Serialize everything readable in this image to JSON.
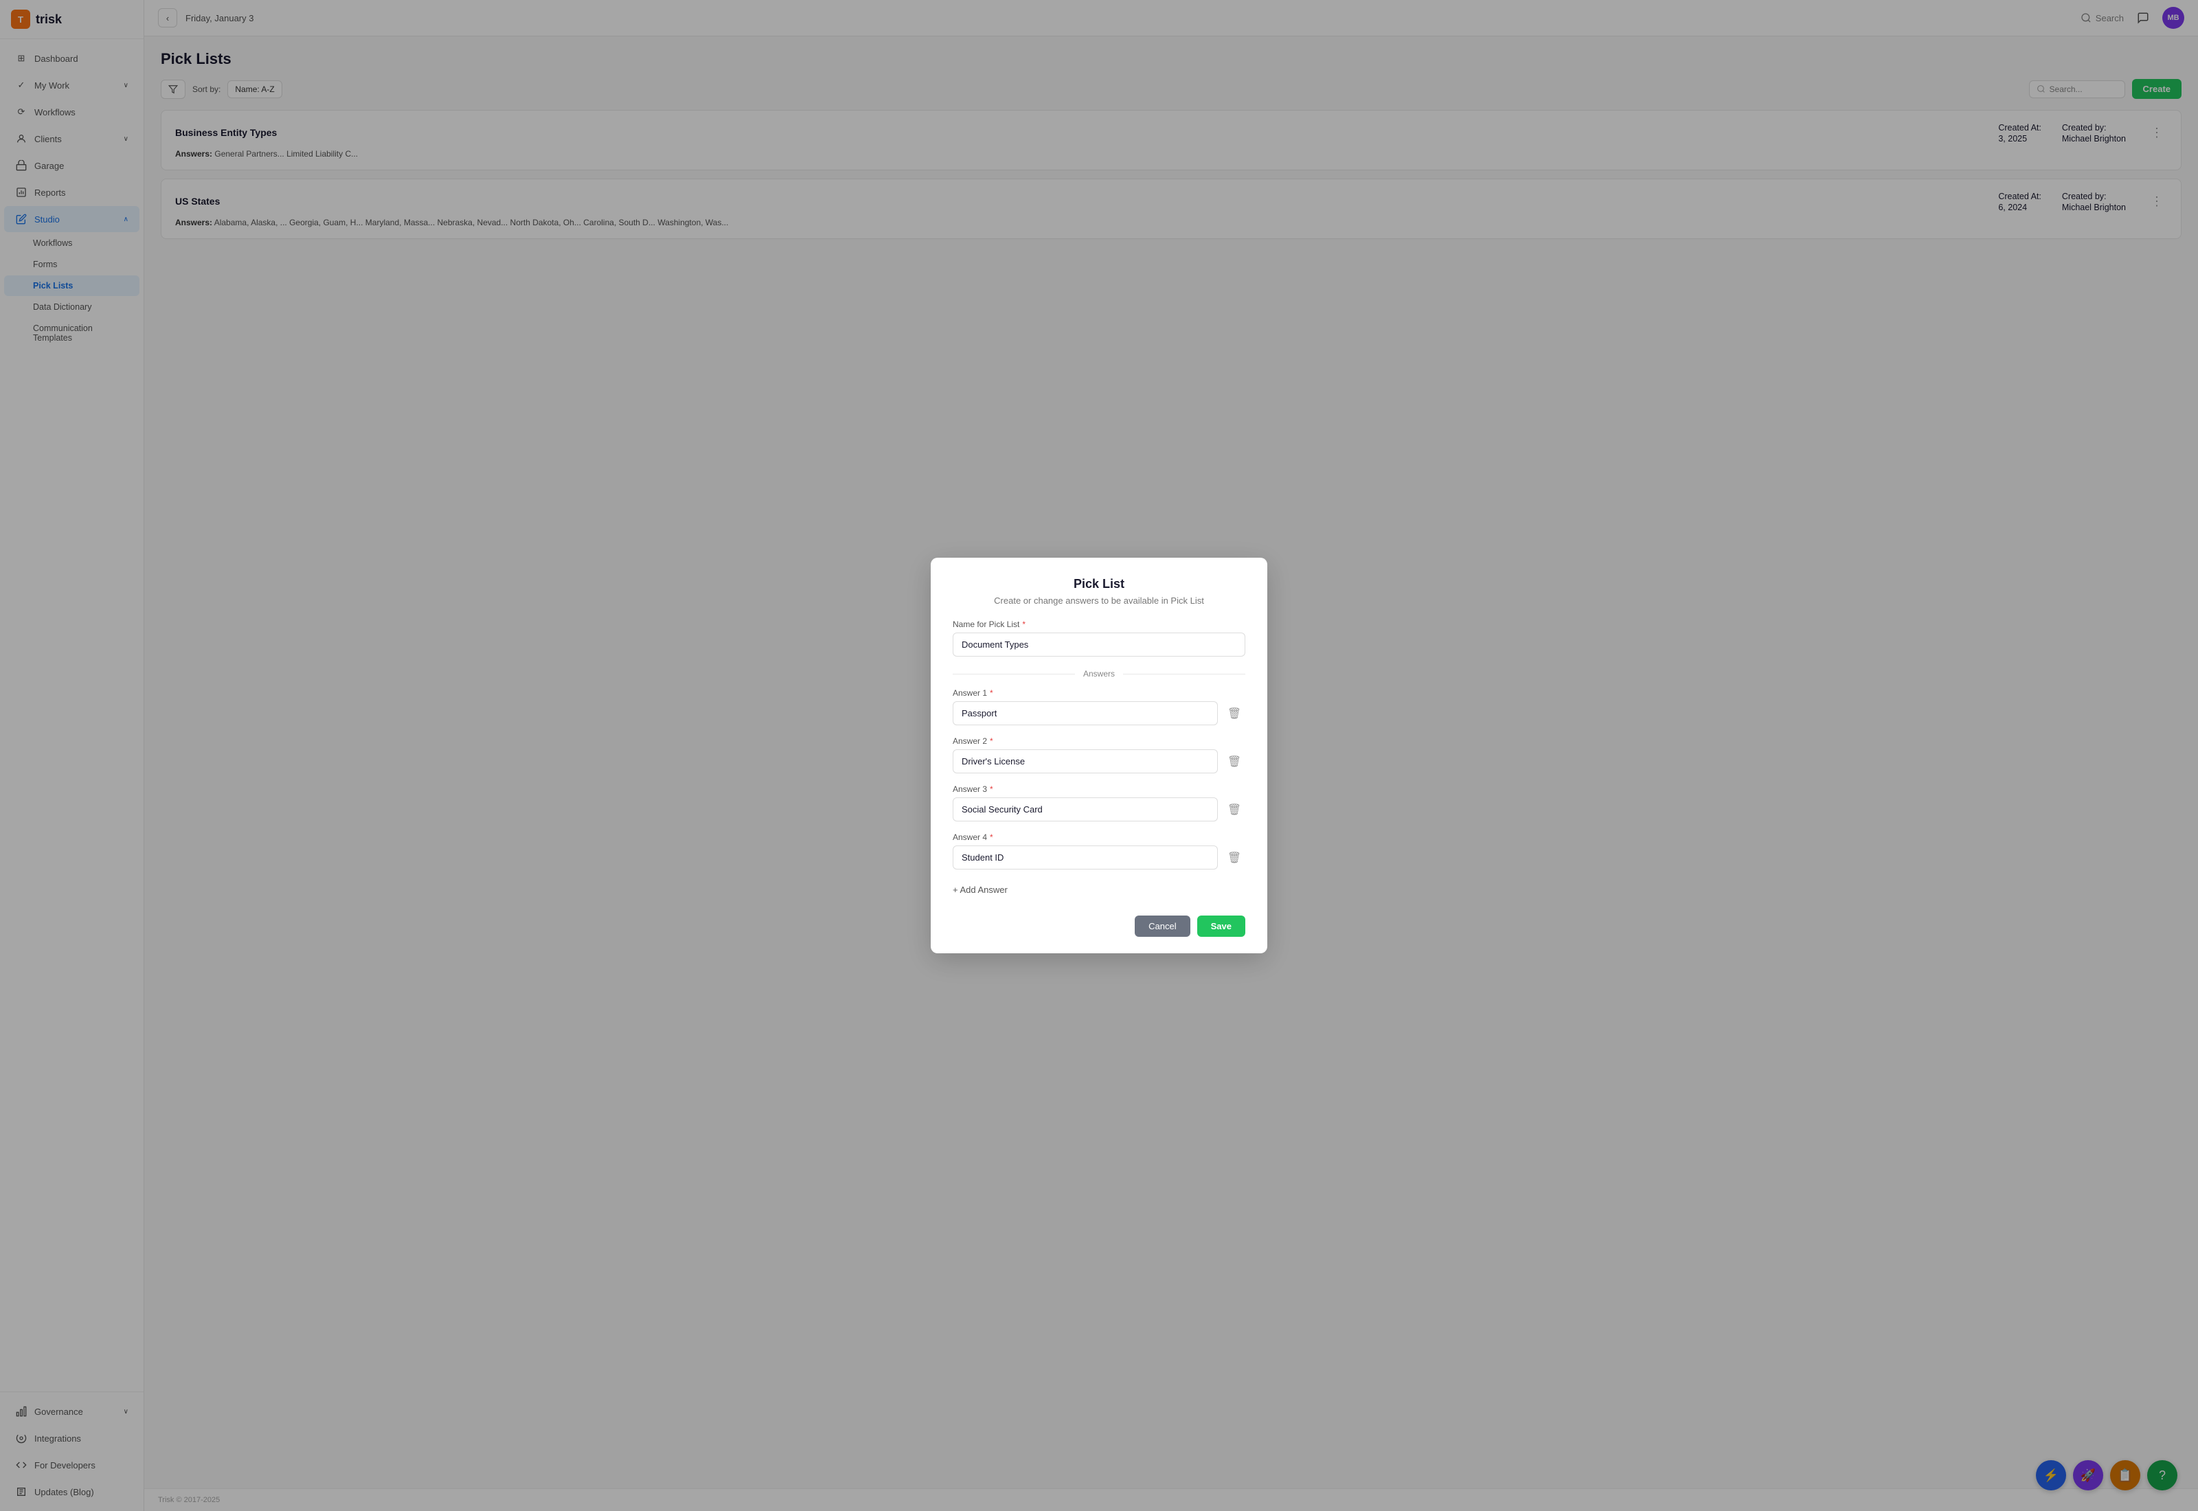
{
  "app": {
    "logo_text": "trisk",
    "logo_icon": "T"
  },
  "header": {
    "back_label": "‹",
    "date": "Friday, January 3",
    "search_label": "Search",
    "avatar_initials": "MB"
  },
  "sidebar": {
    "nav_items": [
      {
        "id": "dashboard",
        "label": "Dashboard",
        "icon": "⊞",
        "active": false
      },
      {
        "id": "my-work",
        "label": "My Work",
        "icon": "✓",
        "active": false,
        "chevron": "∨"
      },
      {
        "id": "workflows",
        "label": "Workflows",
        "icon": "⟳",
        "active": false
      },
      {
        "id": "clients",
        "label": "Clients",
        "icon": "👤",
        "active": false,
        "chevron": "∨"
      },
      {
        "id": "garage",
        "label": "Garage",
        "icon": "🏠",
        "active": false
      },
      {
        "id": "reports",
        "label": "Reports",
        "icon": "📄",
        "active": false
      },
      {
        "id": "studio",
        "label": "Studio",
        "icon": "✏️",
        "active": true,
        "chevron": "∧"
      }
    ],
    "studio_sub": [
      {
        "id": "workflows-sub",
        "label": "Workflows",
        "active": false
      },
      {
        "id": "forms-sub",
        "label": "Forms",
        "active": false
      },
      {
        "id": "pick-lists-sub",
        "label": "Pick Lists",
        "active": true
      },
      {
        "id": "data-dictionary-sub",
        "label": "Data Dictionary",
        "active": false
      },
      {
        "id": "communication-templates-sub",
        "label": "Communication Templates",
        "active": false
      }
    ],
    "bottom_items": [
      {
        "id": "governance",
        "label": "Governance",
        "icon": "🏛",
        "chevron": "∨"
      },
      {
        "id": "integrations",
        "label": "Integrations",
        "icon": "⚙"
      },
      {
        "id": "for-developers",
        "label": "For Developers",
        "icon": "⌨"
      },
      {
        "id": "updates-blog",
        "label": "Updates (Blog)",
        "icon": "📰"
      }
    ]
  },
  "page": {
    "title": "Pick Lists",
    "sort_by_label": "Sort by:",
    "sort_value": "Name: A-Z",
    "search_placeholder": "Search...",
    "create_label": "Create"
  },
  "list_items": [
    {
      "title": "Business Entity Types",
      "answers_label": "Answers:",
      "answers_text": "General Partners... Limited Liability C...",
      "created_at_label": "Created At:",
      "created_at": "3, 2025",
      "created_by_label": "Created by:",
      "created_by": "Michael Brighton"
    },
    {
      "title": "US States",
      "answers_label": "Answers:",
      "answers_text": "Alabama, Alaska, ... Georgia, Guam, H... Maryland, Massa... Nebraska, Nevad... North Dakota, Oh... Carolina, South D... Washington, Was...",
      "created_at_label": "Created At:",
      "created_at": "6, 2024",
      "created_by_label": "Created by:",
      "created_by": "Michael Brighton"
    }
  ],
  "modal": {
    "title": "Pick List",
    "subtitle": "Create or change answers to be available in Pick List",
    "name_label": "Name for Pick List",
    "name_value": "Document Types",
    "answers_divider": "Answers",
    "answers": [
      {
        "label": "Answer 1",
        "value": "Passport"
      },
      {
        "label": "Answer 2",
        "value": "Driver's License"
      },
      {
        "label": "Answer 3",
        "value": "Social Security Card"
      },
      {
        "label": "Answer 4",
        "value": "Student ID"
      }
    ],
    "add_answer_label": "+ Add Answer",
    "cancel_label": "Cancel",
    "save_label": "Save"
  },
  "footer": {
    "text": "Trisk © 2017-2025"
  },
  "fabs": [
    {
      "id": "fab-bolt",
      "color": "#2563eb",
      "icon": "⚡"
    },
    {
      "id": "fab-rocket",
      "color": "#7c3aed",
      "icon": "🚀"
    },
    {
      "id": "fab-doc",
      "color": "#d97706",
      "icon": "📋"
    },
    {
      "id": "fab-help",
      "color": "#16a34a",
      "icon": "?"
    }
  ],
  "colors": {
    "accent_blue": "#1a73e8",
    "accent_green": "#22c55e",
    "accent_orange": "#f97316",
    "sidebar_active_bg": "#e8f4ff",
    "sidebar_active_text": "#1a73e8"
  }
}
